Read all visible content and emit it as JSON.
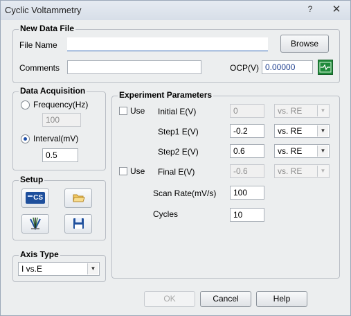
{
  "window": {
    "title": "Cyclic Voltammetry",
    "help_glyph": "?",
    "close_glyph": "✕"
  },
  "new_data_file": {
    "legend": "New Data File",
    "file_name_label": "File Name",
    "file_name_value": "",
    "browse_label": "Browse",
    "comments_label": "Comments",
    "comments_value": "",
    "ocp_label": "OCP(V)",
    "ocp_value": "0.00000"
  },
  "data_acquisition": {
    "legend": "Data Acquisition",
    "frequency_label": "Frequency(Hz)",
    "frequency_value": "100",
    "interval_label": "Interval(mV)",
    "interval_value": "0.5",
    "selected": "interval"
  },
  "setup": {
    "legend": "Setup",
    "cs_icon_text": "CS"
  },
  "axis_type": {
    "legend": "Axis Type",
    "selected": "I vs.E"
  },
  "experiment": {
    "legend": "Experiment Parameters",
    "use_label": "Use",
    "initial_label": "Initial E(V)",
    "initial_value": "0",
    "initial_ref": "vs. RE",
    "step1_label": "Step1 E(V)",
    "step1_value": "-0.2",
    "step1_ref": "vs. RE",
    "step2_label": "Step2 E(V)",
    "step2_value": "0.6",
    "step2_ref": "vs. RE",
    "final_label": "Final E(V)",
    "final_value": "-0.6",
    "final_ref": "vs. RE",
    "scan_rate_label": "Scan Rate(mV/s)",
    "scan_rate_value": "100",
    "cycles_label": "Cycles",
    "cycles_value": "10"
  },
  "buttons": {
    "ok": "OK",
    "cancel": "Cancel",
    "help": "Help"
  },
  "colors": {
    "accent": "#1e4fa8",
    "ocp_icon_bg": "#1f8a3a"
  }
}
